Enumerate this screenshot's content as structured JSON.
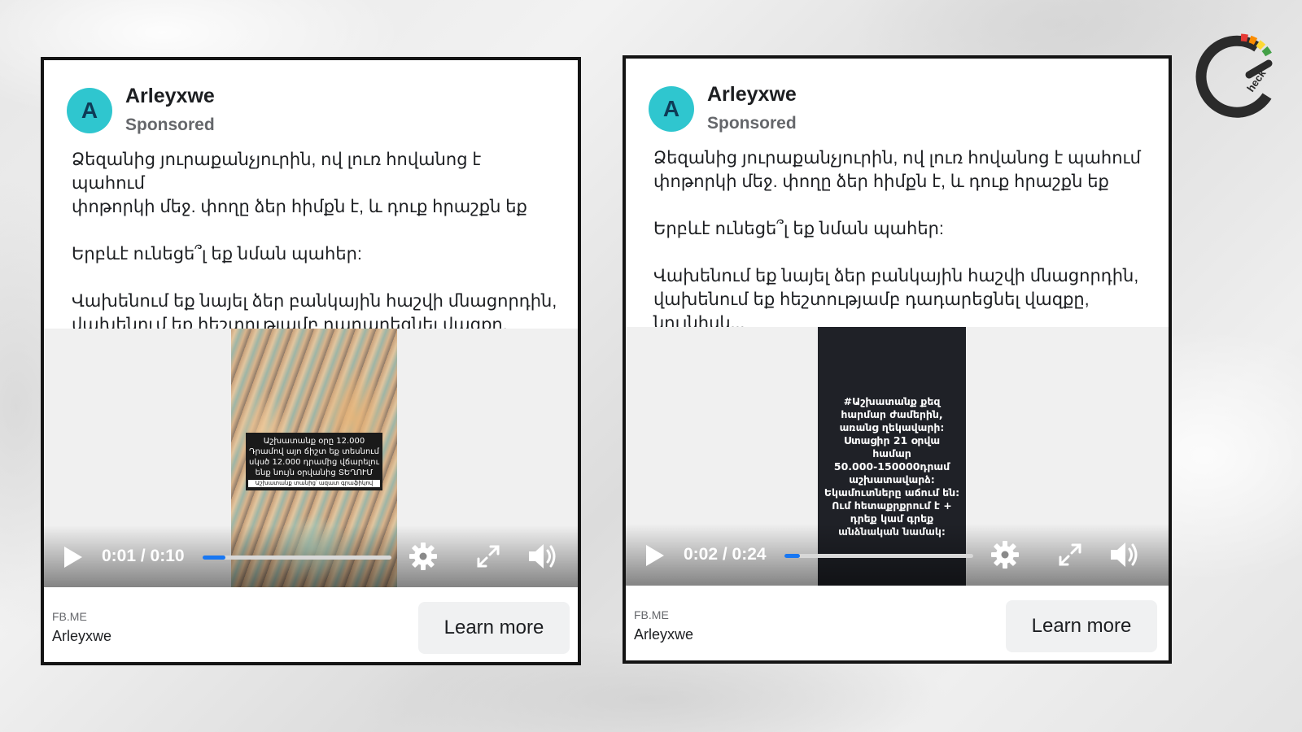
{
  "ads": [
    {
      "advertiser": "Arleyxwe",
      "avatar_letter": "A",
      "sponsored_label": "Sponsored",
      "body": {
        "line1": "Ձեզանից յուրաքանչյուրին, ով լուռ հովանոց է պահում",
        "line2": "փոթորկի մեջ. փողը ձեր հիմքն է, և դուք հրաշքն եք",
        "line3": "Երբևէ ունեցե՞լ եք նման պահեր:",
        "line4": "Վախենում եք նայել ձեր բանկային հաշվի մնացորդին,",
        "line5": "վախենում եք հեշտությամբ դադարեցնել վազքը, նույնիսկ..."
      },
      "video": {
        "overlay_text": "Աշխատանք օրը 12.000 Դրամով այո ճիշտ եք տեսնում սկսծ 12.000 դրամից վճարելու ենք նույն օրվանից ՏԵՂՈՒՄ",
        "overlay_small": "Աշխատանք տանից՝ ազատ գրաֆիկով",
        "time": "0:01 / 0:10",
        "progress": 0.12
      },
      "footer": {
        "domain": "FB.ME",
        "name": "Arleyxwe",
        "cta": "Learn more"
      }
    },
    {
      "advertiser": "Arleyxwe",
      "avatar_letter": "A",
      "sponsored_label": "Sponsored",
      "body": {
        "line1": "Ձեզանից յուրաքանչյուրին, ով լուռ հովանոց է պահում",
        "line2": "փոթորկի մեջ. փողը ձեր հիմքն է, և դուք հրաշքն եք",
        "line3": "Երբևէ ունեցե՞լ եք նման պահեր:",
        "line4": "Վախենում եք նայել ձեր բանկային հաշվի մնացորդին,",
        "line5": "վախենում եք հեշտությամբ դադարեցնել վազքը, նույնիսկ..."
      },
      "video": {
        "overlay_text": "#Աշխատանք քեզ\nհարմար ժամերին,\nառանց ղեկավարի:\nՍտացիր 21 օրվա համար\n50.000-150000դրամ\nաշխատավարձ:\nԵկամուտները աճում են:\nՈւմ հետաքրքրում է +\nդրեք կամ գրեք\nանձնական նամակ:",
        "time": "0:02 / 0:24",
        "progress": 0.08
      },
      "footer": {
        "domain": "FB.ME",
        "name": "Arleyxwe",
        "cta": "Learn more"
      }
    }
  ],
  "logo": {
    "text": "heck",
    "icon": "c-check-logo"
  },
  "colors": {
    "avatar": "#2fc6cf",
    "progress": "#1877f2"
  }
}
